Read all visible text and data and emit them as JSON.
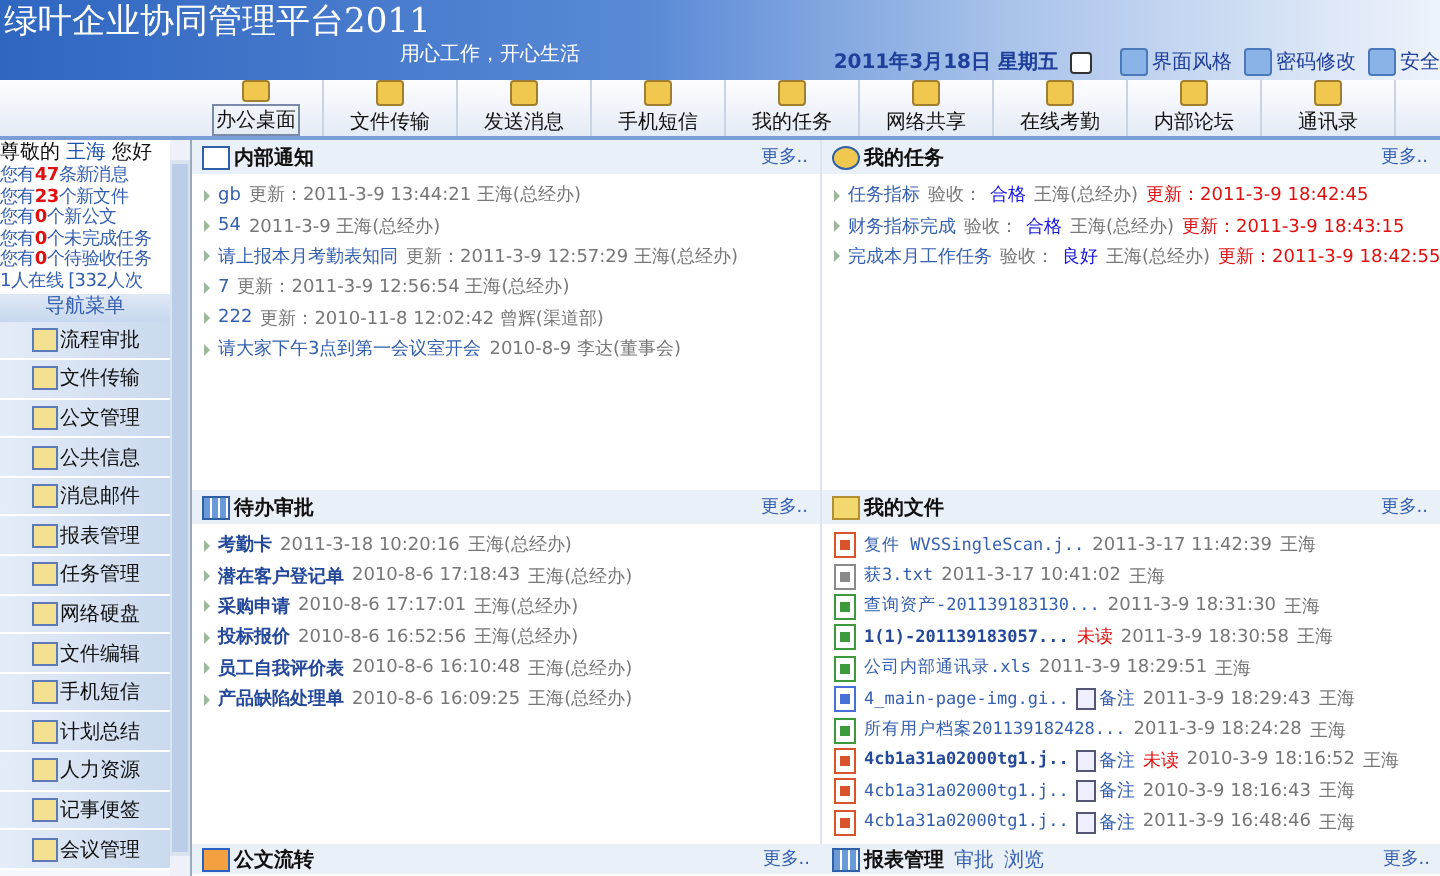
{
  "header": {
    "title": "绿叶企业协同管理平台2011",
    "slogan": "用心工作，开心生活",
    "date": "2011年3月18日  星期五",
    "links": [
      "界面风格",
      "密码修改",
      "安全"
    ]
  },
  "toolbar": [
    {
      "label": "办公桌面",
      "selected": true
    },
    {
      "label": "文件传输",
      "selected": false
    },
    {
      "label": "发送消息",
      "selected": false
    },
    {
      "label": "手机短信",
      "selected": false
    },
    {
      "label": "我的任务",
      "selected": false
    },
    {
      "label": "网络共享",
      "selected": false
    },
    {
      "label": "在线考勤",
      "selected": false
    },
    {
      "label": "内部论坛",
      "selected": false
    },
    {
      "label": "通讯录",
      "selected": false
    }
  ],
  "sidebar": {
    "greeting": [
      "尊敬的",
      "王海",
      "您好"
    ],
    "stats": [
      {
        "prefix": "您有",
        "count": "47",
        "suffix": "条新消息"
      },
      {
        "prefix": "您有",
        "count": "23",
        "suffix": "个新文件"
      },
      {
        "prefix": "您有",
        "count": "0",
        "suffix": "个新公文"
      },
      {
        "prefix": "您有",
        "count": "0",
        "suffix": "个未完成任务"
      },
      {
        "prefix": "您有",
        "count": "0",
        "suffix": "个待验收任务"
      }
    ],
    "online": "1人在线 [332人次",
    "menu_title": "导航菜单",
    "menu": [
      "流程审批",
      "文件传输",
      "公文管理",
      "公共信息",
      "消息邮件",
      "报表管理",
      "任务管理",
      "网络硬盘",
      "文件编辑",
      "手机短信",
      "计划总结",
      "人力资源",
      "记事便签",
      "会议管理"
    ]
  },
  "notices": {
    "title": "内部通知",
    "more": "更多..",
    "items": [
      {
        "title": "gb",
        "meta": "更新：2011-3-9 13:44:21 王海(总经办)"
      },
      {
        "title": "54",
        "meta": "2011-3-9 王海(总经办)"
      },
      {
        "title": "请上报本月考勤表知同",
        "meta": "更新：2011-3-9 12:57:29 王海(总经办)"
      },
      {
        "title": "7",
        "meta": "更新：2011-3-9 12:56:54 王海(总经办)"
      },
      {
        "title": "222",
        "meta": "更新：2010-11-8 12:02:42 曾辉(渠道部)"
      },
      {
        "title": "请大家下午3点到第一会议室开会",
        "meta": "2010-8-9 李达(董事会)"
      }
    ]
  },
  "tasks": {
    "title": "我的任务",
    "more": "更多..",
    "items": [
      {
        "name": "任务指标",
        "check_label": "验收：",
        "grade": "合格",
        "user": "王海(总经办)",
        "updated": "更新：2011-3-9 18:42:45"
      },
      {
        "name": "财务指标完成",
        "check_label": "验收：",
        "grade": "合格",
        "user": "王海(总经办)",
        "updated": "更新：2011-3-9 18:43:15"
      },
      {
        "name": "完成本月工作任务",
        "check_label": "验收：",
        "grade": "良好",
        "user": "王海(总经办)",
        "updated": "更新：2011-3-9 18:42:55"
      }
    ]
  },
  "approvals": {
    "title": "待办审批",
    "more": "更多..",
    "items": [
      {
        "name": "考勤卡",
        "time": "2011-3-18 10:20:16",
        "user": "王海(总经办)"
      },
      {
        "name": "潜在客户登记单",
        "time": "2010-8-6 17:18:43",
        "user": "王海(总经办)"
      },
      {
        "name": "采购申请",
        "time": "2010-8-6 17:17:01",
        "user": "王海(总经办)"
      },
      {
        "name": "投标报价",
        "time": "2010-8-6 16:52:56",
        "user": "王海(总经办)"
      },
      {
        "name": "员工自我评价表",
        "time": "2010-8-6 16:10:48",
        "user": "王海(总经办)"
      },
      {
        "name": "产品缺陷处理单",
        "time": "2010-8-6 16:09:25",
        "user": "王海(总经办)"
      }
    ]
  },
  "files": {
    "title": "我的文件",
    "more": "更多..",
    "items": [
      {
        "kind": "image",
        "name": "复件 WVSSingleScan.j..",
        "unread": false,
        "time": "2011-3-17 11:42:39",
        "user": "王海"
      },
      {
        "kind": "text",
        "name": "获3.txt",
        "unread": false,
        "time": "2011-3-17 10:41:02",
        "user": "王海"
      },
      {
        "kind": "sheet",
        "name": "查询资产-201139183130...",
        "unread": false,
        "time": "2011-3-9 18:31:30",
        "user": "王海"
      },
      {
        "kind": "sheet",
        "name": "1(1)-201139183057...",
        "unread": true,
        "unread_label": "未读",
        "time": "2011-3-9 18:30:58",
        "user": "王海"
      },
      {
        "kind": "sheet",
        "name": "公司内部通讯录.xls",
        "unread": false,
        "time": "2011-3-9 18:29:51",
        "user": "王海"
      },
      {
        "kind": "gif",
        "name": "4_main-page-img.gi..",
        "note": "备注",
        "unread": false,
        "time": "2011-3-9 18:29:43",
        "user": "王海"
      },
      {
        "kind": "sheet",
        "name": "所有用户档案201139182428...",
        "unread": false,
        "time": "2011-3-9 18:24:28",
        "user": "王海"
      },
      {
        "kind": "image",
        "name": "4cb1a31a02000tg1.j..",
        "note": "备注",
        "unread": true,
        "unread_label": "未读",
        "time": "2010-3-9 18:16:52",
        "user": "王海"
      },
      {
        "kind": "image",
        "name": "4cb1a31a02000tg1.j..",
        "note": "备注",
        "unread": false,
        "time": "2010-3-9 18:16:43",
        "user": "王海"
      },
      {
        "kind": "image",
        "name": "4cb1a31a02000tg1.j..",
        "note": "备注",
        "unread": false,
        "time": "2011-3-9 16:48:46",
        "user": "王海"
      }
    ]
  },
  "bottom_left": {
    "title": "公文流转",
    "more": "更多.."
  },
  "bottom_right": {
    "title": "报表管理",
    "links": [
      "审批",
      "浏览"
    ],
    "more": "更多.."
  }
}
